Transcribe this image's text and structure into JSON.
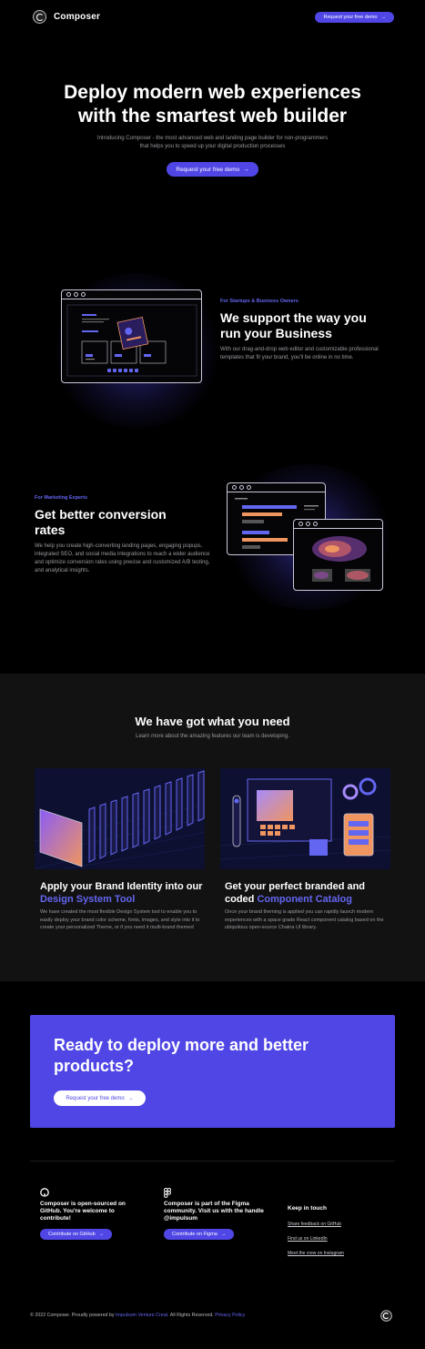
{
  "header": {
    "brand": "Composer",
    "cta_label": "Request your free demo"
  },
  "hero": {
    "title_line1": "Deploy modern web experiences",
    "title_line2": "with the smartest web builder",
    "subtitle_line1": "Introducing Composer - the most advanced web and landing page builder for non-programmers",
    "subtitle_line2": "that helps you to speed up your digital production processes",
    "cta_label": "Request your free demo"
  },
  "feature1": {
    "label": "For Startups & Business Owners",
    "title": "We support the way you run your Business",
    "description": "With our drag-and-drop web editor and customizable professional templates that fit your brand, you'll be online in no time."
  },
  "feature2": {
    "label": "For Marketing Experts",
    "title": "Get better conversion rates",
    "description": "We help you create high-converting landing pages, engaging popups, integrated SEO, and social media integrations to reach a wider audience and optimize conversion rates using precise and customized A/B testing, and analytical insights."
  },
  "features": {
    "title": "We have got what you need",
    "subtitle": "Learn more about the amazing features our team is developing.",
    "cards": [
      {
        "title_prefix": "Apply your Brand Identity into our ",
        "title_accent": "Design System Tool",
        "description": "We have created the most flexible Design System tool to enable you to easily deploy your brand color scheme, fonts, images, and style into it to create your personalized Theme, or if you need it multi-brand themes!"
      },
      {
        "title_prefix": "Get your perfect branded and coded ",
        "title_accent": "Component Catalog",
        "description": "Once your brand theming is applied you can rapidly launch modern experiences with a space grade React component catalog based on the ubiquitous open-source Chakra UI library."
      }
    ]
  },
  "cta": {
    "title": "Ready to deploy more and better products?",
    "button_label": "Request your free demo"
  },
  "footer": {
    "github_text": "Composer is open-sourced on GitHub. You're welcome to contribute!",
    "github_button": "Contribute on GitHub",
    "figma_text": "Composer is part of the Figma community. Visit us with the handle @impulsum",
    "figma_button": "Contribute on Figma",
    "keep_title": "Keep in touch",
    "links": [
      "Share feedback on GitHub",
      "Find us on LinkedIn",
      "Meet the crew on Instagram"
    ],
    "copyright_prefix": "© 2022 Composer. Proudly powered by ",
    "copyright_company": "Impulsum Venture Creat.",
    "copyright_mid": " All Rights Reserved. ",
    "copyright_policy": "Privacy Policy"
  },
  "colors": {
    "accent": "#4f46e5",
    "accent_text": "#6366f1",
    "orange": "#f0955f",
    "background": "#000000",
    "section_gray": "#121212"
  },
  "icons": [
    "arrow-right-icon",
    "github-icon",
    "figma-icon",
    "composer-logo-icon"
  ]
}
